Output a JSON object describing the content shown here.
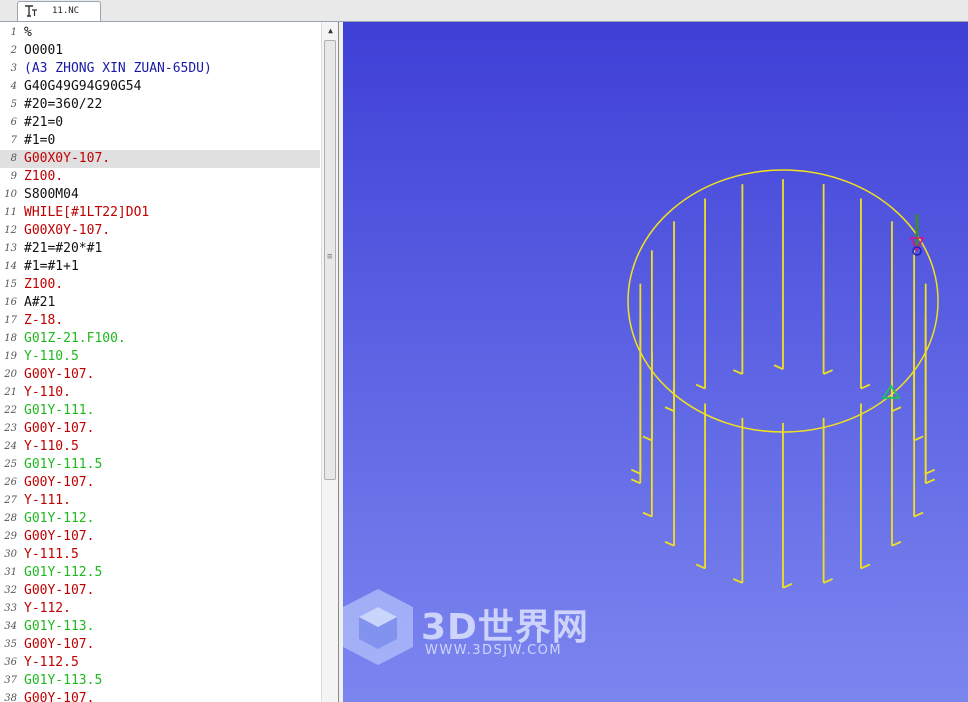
{
  "tab": {
    "title": "11.NC",
    "icon": "nc-program-icon"
  },
  "editor": {
    "current_line": 8,
    "lines": [
      {
        "n": "1",
        "text": "%",
        "color": "black"
      },
      {
        "n": "2",
        "text": "O0001",
        "color": "black"
      },
      {
        "n": "3",
        "text": "(A3 ZHONG XIN ZUAN-65DU)",
        "color": "blue"
      },
      {
        "n": "4",
        "text": "G40G49G94G90G54",
        "color": "black"
      },
      {
        "n": "5",
        "text": "#20=360/22",
        "color": "black"
      },
      {
        "n": "6",
        "text": "#21=0",
        "color": "black"
      },
      {
        "n": "7",
        "text": "#1=0",
        "color": "black"
      },
      {
        "n": "8",
        "text": "G00X0Y-107.",
        "color": "red"
      },
      {
        "n": "9",
        "text": "Z100.",
        "color": "red"
      },
      {
        "n": "10",
        "text": "S800M04",
        "color": "black"
      },
      {
        "n": "11",
        "text": "WHILE[#1LT22]DO1",
        "color": "red"
      },
      {
        "n": "12",
        "text": "G00X0Y-107.",
        "color": "red"
      },
      {
        "n": "13",
        "text": "#21=#20*#1",
        "color": "black"
      },
      {
        "n": "14",
        "text": "#1=#1+1",
        "color": "black"
      },
      {
        "n": "15",
        "text": "Z100.",
        "color": "red"
      },
      {
        "n": "16",
        "text": "A#21",
        "color": "black"
      },
      {
        "n": "17",
        "text": "Z-18.",
        "color": "red"
      },
      {
        "n": "18",
        "text": "G01Z-21.F100.",
        "color": "green"
      },
      {
        "n": "19",
        "text": "Y-110.5",
        "color": "green"
      },
      {
        "n": "20",
        "text": "G00Y-107.",
        "color": "red"
      },
      {
        "n": "21",
        "text": "Y-110.",
        "color": "red"
      },
      {
        "n": "22",
        "text": "G01Y-111.",
        "color": "green"
      },
      {
        "n": "23",
        "text": "G00Y-107.",
        "color": "red"
      },
      {
        "n": "24",
        "text": "Y-110.5",
        "color": "red"
      },
      {
        "n": "25",
        "text": "G01Y-111.5",
        "color": "green"
      },
      {
        "n": "26",
        "text": "G00Y-107.",
        "color": "red"
      },
      {
        "n": "27",
        "text": "Y-111.",
        "color": "red"
      },
      {
        "n": "28",
        "text": "G01Y-112.",
        "color": "green"
      },
      {
        "n": "29",
        "text": "G00Y-107.",
        "color": "red"
      },
      {
        "n": "30",
        "text": "Y-111.5",
        "color": "red"
      },
      {
        "n": "31",
        "text": "G01Y-112.5",
        "color": "green"
      },
      {
        "n": "32",
        "text": "G00Y-107.",
        "color": "red"
      },
      {
        "n": "33",
        "text": "Y-112.",
        "color": "red"
      },
      {
        "n": "34",
        "text": "G01Y-113.",
        "color": "green"
      },
      {
        "n": "35",
        "text": "G00Y-107.",
        "color": "red"
      },
      {
        "n": "36",
        "text": "Y-112.5",
        "color": "red"
      },
      {
        "n": "37",
        "text": "G01Y-113.5",
        "color": "green"
      },
      {
        "n": "38",
        "text": "G00Y-107.",
        "color": "red"
      }
    ]
  },
  "viewport": {
    "toolpath_color": "#f0e020",
    "background_top": "#3f3fd6",
    "background_bottom": "#7c86ef"
  },
  "watermark": {
    "title": "3D世界网",
    "subtitle": "WWW.3DSJW.COM",
    "icon": "cube-logo-icon"
  },
  "colors": {
    "black": "#111111",
    "red": "#c00000",
    "green": "#1fb81f",
    "blue": "#1a1aa8"
  }
}
